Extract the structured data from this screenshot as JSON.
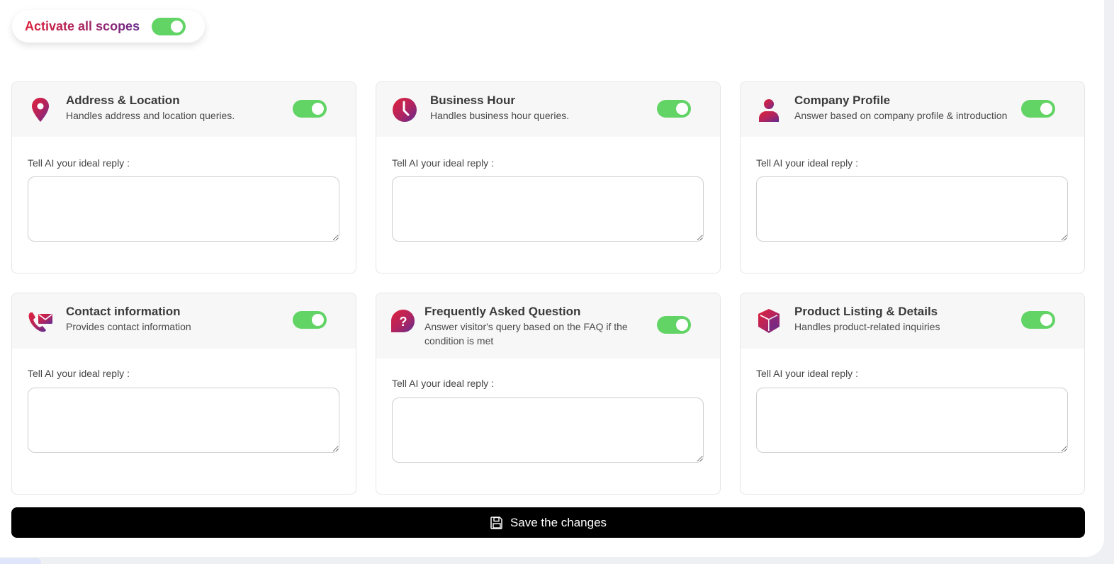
{
  "master": {
    "label": "Activate all scopes",
    "enabled": true
  },
  "reply_label": "Tell AI your ideal reply :",
  "scopes": [
    {
      "title": "Address & Location",
      "desc": "Handles address and location queries.",
      "icon": "location-pin-icon",
      "enabled": true,
      "reply": ""
    },
    {
      "title": "Business Hour",
      "desc": "Handles business hour queries.",
      "icon": "clock-icon",
      "enabled": true,
      "reply": ""
    },
    {
      "title": "Company Profile",
      "desc": "Answer based on company profile & introduction",
      "icon": "person-icon",
      "enabled": true,
      "reply": ""
    },
    {
      "title": "Contact information",
      "desc": "Provides contact information",
      "icon": "phone-mail-icon",
      "enabled": true,
      "reply": ""
    },
    {
      "title": "Frequently Asked Question",
      "desc": "Answer visitor's query based on the FAQ if the condition is met",
      "icon": "question-bubble-icon",
      "enabled": true,
      "reply": ""
    },
    {
      "title": "Product Listing & Details",
      "desc": "Handles product-related inquiries",
      "icon": "box-icon",
      "enabled": true,
      "reply": ""
    }
  ],
  "save_label": "Save the changes",
  "colors": {
    "toggle_on": "#62d466",
    "gradient_start": "#d8203b",
    "gradient_end": "#6a2b8c",
    "button_bg": "#000000"
  }
}
